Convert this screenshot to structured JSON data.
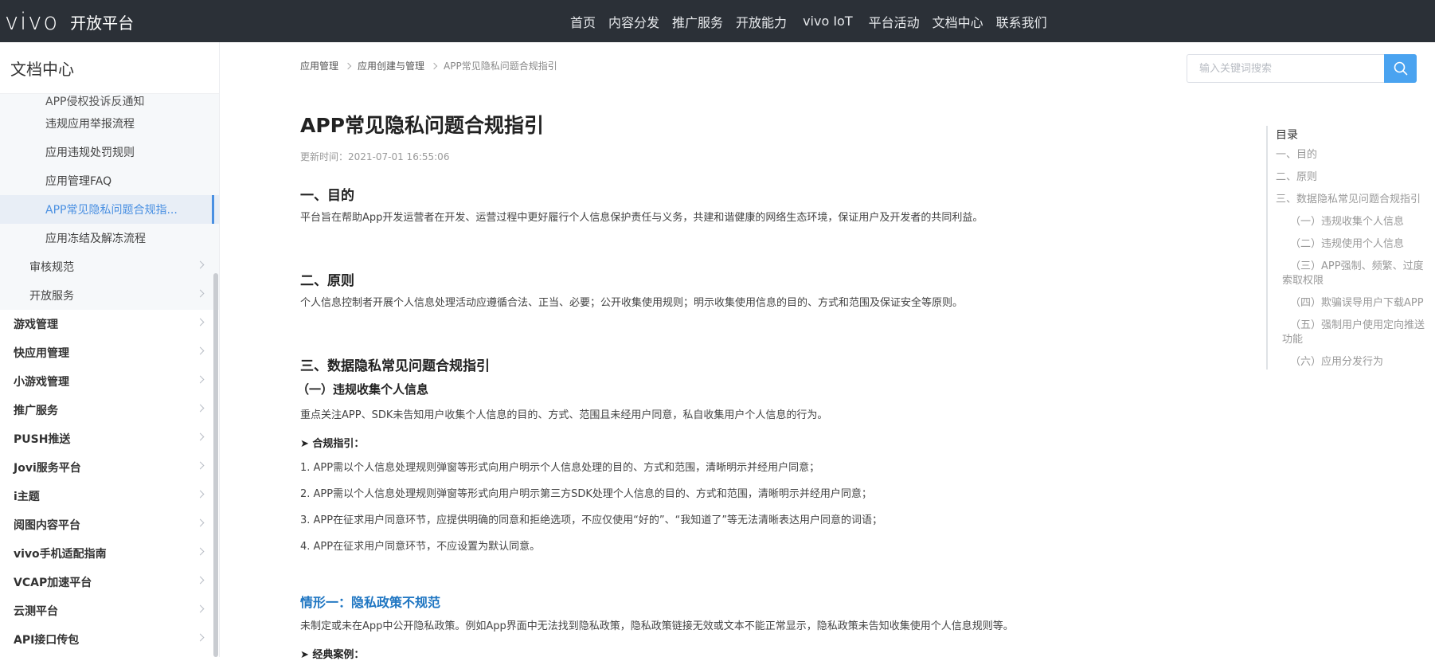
{
  "header": {
    "logo_text": "vivo",
    "logo_sub": "开放平台",
    "nav": [
      "首页",
      "内容分发",
      "推广服务",
      "开放能力",
      "vivo IoT",
      "平台活动",
      "文档中心",
      "联系我们"
    ]
  },
  "sidebar": {
    "title": "文档中心",
    "sub_items": [
      "APP侵权投诉反通知",
      "违规应用举报流程",
      "应用违规处罚规则",
      "应用管理FAQ",
      "APP常见隐私问题合规指...",
      "应用冻结及解冻流程"
    ],
    "group_items": [
      "审核规范",
      "开放服务"
    ],
    "top_items": [
      "游戏管理",
      "快应用管理",
      "小游戏管理",
      "推广服务",
      "PUSH推送",
      "Jovi服务平台",
      "i主题",
      "阅图内容平台",
      "vivo手机适配指南",
      "VCAP加速平台",
      "云测平台",
      "API接口传包"
    ]
  },
  "breadcrumb": [
    "应用管理",
    "应用创建与管理",
    "APP常见隐私问题合规指引"
  ],
  "search": {
    "placeholder": "输入关键词搜索"
  },
  "article": {
    "title": "APP常见隐私问题合规指引",
    "update_time": "更新时间：2021-07-01 16:55:06",
    "s1_title": "一、目的",
    "s1_text": "平台旨在帮助App开发运营者在开发、运营过程中更好履行个人信息保护责任与义务，共建和谐健康的网络生态环境，保证用户及开发者的共同利益。",
    "s2_title": "二、原则",
    "s2_text": "个人信息控制者开展个人信息处理活动应遵循合法、正当、必要；公开收集使用规则；明示收集使用信息的目的、方式和范围及保证安全等原则。",
    "s3_title": "三、数据隐私常见问题合规指引",
    "s3_1_title": "（一）违规收集个人信息",
    "s3_1_text": "重点关注APP、SDK未告知用户收集个人信息的目的、方式、范围且未经用户同意，私自收集用户个人信息的行为。",
    "guide_label": "➤  合规指引：",
    "rules": [
      "1. APP需以个人信息处理规则弹窗等形式向用户明示个人信息处理的目的、方式和范围，清晰明示并经用户同意；",
      "2. APP需以个人信息处理规则弹窗等形式向用户明示第三方SDK处理个人信息的目的、方式和范围，清晰明示并经用户同意；",
      "3. APP在征求用户同意环节，应提供明确的同意和拒绝选项，不应仅使用“好的”、“我知道了”等无法清晰表达用户同意的词语；",
      "4. APP在征求用户同意环节，不应设置为默认同意。"
    ],
    "case1_title": "情形一：隐私政策不规范",
    "case1_text": "未制定或未在App中公开隐私政策。例如App界面中无法找到隐私政策，隐私政策链接无效或文本不能正常显示，隐私政策未告知收集使用个人信息规则等。",
    "example_label": "➤  经典案例："
  },
  "toc": {
    "head": "目录",
    "items": [
      "一、目的",
      "二、原则",
      "三、数据隐私常见问题合规指引",
      "（一）违规收集个人信息",
      "（二）违规使用个人信息",
      "（三）APP强制、频繁、过度索取权限",
      "（四）欺骗误导用户下载APP",
      "（五）强制用户使用定向推送功能",
      "（六）应用分发行为"
    ]
  },
  "colors": {
    "header_bg": "#2b3037",
    "accent": "#4a90e2",
    "search_btn": "#4aa3f0",
    "case_title": "#1f76c2"
  }
}
